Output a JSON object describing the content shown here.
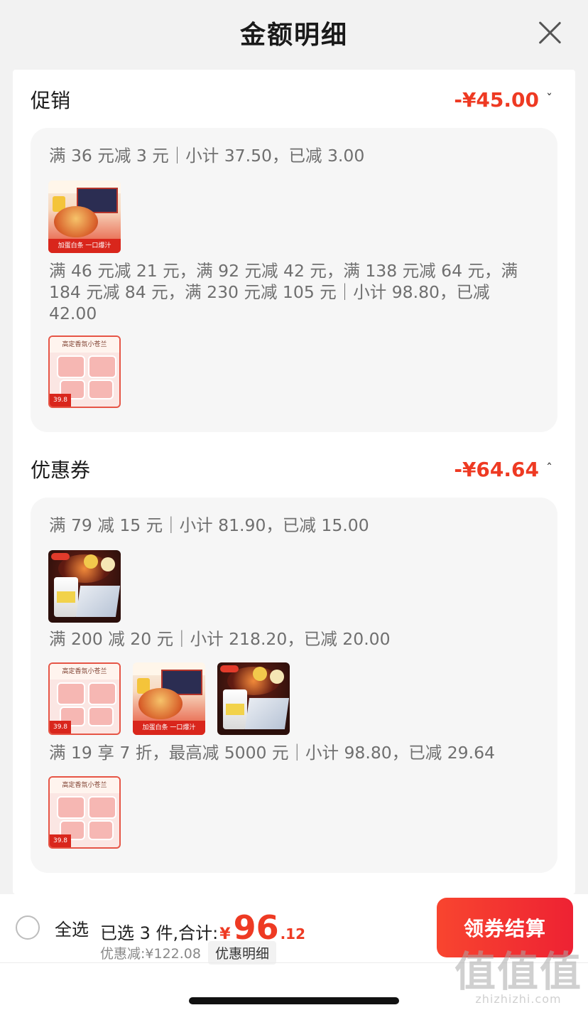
{
  "sheet": {
    "title": "金额明细",
    "close_icon": "close-icon"
  },
  "promotion": {
    "title": "促销",
    "amount": "-¥45.00",
    "chevron": "ˇ",
    "groups": [
      {
        "rule": "满 36 元减 3 元｜小计 37.50，已减 3.00",
        "products": [
          {
            "thumb": "noodle",
            "caption": "加蛋白条 一口爆汁"
          }
        ]
      },
      {
        "rule": "满 46 元减 21 元，满 92 元减 42 元，满 138 元减 64 元，满 184 元减 84 元，满 230 元减 105 元｜小计 98.80，已减 42.00",
        "products": [
          {
            "thumb": "pink",
            "caption": "高定香氛小苍兰",
            "price": "39.8"
          }
        ]
      }
    ]
  },
  "coupon": {
    "title": "优惠券",
    "amount": "-¥64.64",
    "chevron": "ˆ",
    "groups": [
      {
        "rule": "满 79 减 15 元｜小计 81.90，已减 15.00",
        "products": [
          {
            "thumb": "red"
          }
        ]
      },
      {
        "rule": "满 200 减 20 元｜小计 218.20，已减 20.00",
        "products": [
          {
            "thumb": "pink",
            "caption": "高定香氛小苍兰",
            "price": "39.8"
          },
          {
            "thumb": "noodle",
            "caption": "加蛋白条 一口爆汁"
          },
          {
            "thumb": "red"
          }
        ]
      },
      {
        "rule": "满 19 享 7 折，最高减 5000 元｜小计 98.80，已减 29.64",
        "products": [
          {
            "thumb": "pink",
            "caption": "高定香氛小苍兰",
            "price": "39.8"
          }
        ]
      }
    ]
  },
  "footer": {
    "select_all": "全选",
    "summary_label": "已选 3 件,合计:",
    "currency": "¥",
    "total_int": "96",
    "total_dec": ".12",
    "discount_label": "优惠减:¥122.08",
    "detail_label": "优惠明细",
    "checkout_label": "领券结算"
  },
  "watermark": {
    "glyphs": "值值值",
    "site": "zhizhizhi.com"
  },
  "colors": {
    "accent": "#ee3a23",
    "button": "#f8452f"
  }
}
